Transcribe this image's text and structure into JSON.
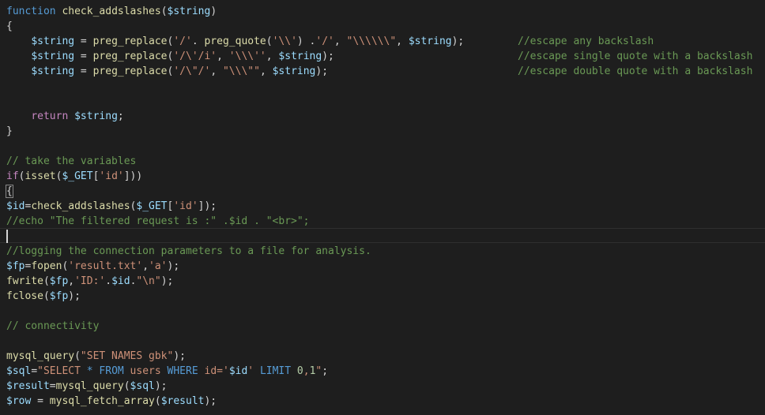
{
  "colors": {
    "background": "#1e1e1e",
    "text": "#d4d4d4",
    "keyword": "#569cd6",
    "control": "#c586c0",
    "function": "#dcdcaa",
    "variable": "#9cdcfe",
    "string": "#ce9178",
    "comment": "#6a9955",
    "number": "#b5cea8"
  },
  "code": {
    "l1": {
      "kw": "function",
      "fn": "check_addslashes",
      "open": "(",
      "var": "$string",
      "close": ")"
    },
    "l2": {
      "brace": "{"
    },
    "l3": {
      "indent": "    ",
      "var1": "$string",
      "eq": " = ",
      "fn1": "preg_replace",
      "p1": "(",
      "s1": "'/'",
      "dot1": ". ",
      "fn2": "preg_quote",
      "p2": "(",
      "s2": "'\\\\'",
      "p3": ") .",
      "s3": "'/'",
      "c1": ", ",
      "s4": "\"\\\\\\\\\\\\\"",
      "c2": ", ",
      "var2": "$string",
      "end": ");",
      "comment": "//escape any backslash"
    },
    "l4": {
      "indent": "    ",
      "var1": "$string",
      "eq": " = ",
      "fn1": "preg_replace",
      "p1": "(",
      "s1": "'/\\'/i'",
      "c1": ", ",
      "s2": "'\\\\\\''",
      "c2": ", ",
      "var2": "$string",
      "end": ");",
      "comment": "//escape single quote with a backslash"
    },
    "l5": {
      "indent": "    ",
      "var1": "$string",
      "eq": " = ",
      "fn1": "preg_replace",
      "p1": "(",
      "s1": "'/\\\"/'",
      "c1": ", ",
      "s2": "\"\\\\\\\"\"",
      "c2": ", ",
      "var2": "$string",
      "end": ");",
      "comment": "//escape double quote with a backslash"
    },
    "l8": {
      "indent": "    ",
      "kw": "return",
      "sp": " ",
      "var": "$string",
      "end": ";"
    },
    "l9": {
      "brace": "}"
    },
    "l11": {
      "comment": "// take the variables"
    },
    "l12": {
      "ctl": "if",
      "p1": "(",
      "fn": "isset",
      "p2": "(",
      "var": "$_GET",
      "b1": "[",
      "s": "'id'",
      "b2": "]))"
    },
    "l13": {
      "brace": "{"
    },
    "l14": {
      "var1": "$id",
      "eq": "=",
      "fn": "check_addslashes",
      "p1": "(",
      "var2": "$_GET",
      "b1": "[",
      "s": "'id'",
      "b2": "]);"
    },
    "l15": {
      "comment": "//echo \"The filtered request is :\" .$id . \"<br>\";"
    },
    "l17": {
      "comment": "//logging the connection parameters to a file for analysis."
    },
    "l18": {
      "var": "$fp",
      "eq": "=",
      "fn": "fopen",
      "p1": "(",
      "s1": "'result.txt'",
      "c": ",",
      "s2": "'a'",
      "end": ");"
    },
    "l19": {
      "fn": "fwrite",
      "p1": "(",
      "var1": "$fp",
      "c": ",",
      "s1": "'ID:'",
      "dot1": ".",
      "var2": "$id",
      "dot2": ".",
      "s2": "\"\\n\"",
      "end": ");"
    },
    "l20": {
      "fn": "fclose",
      "p1": "(",
      "var": "$fp",
      "end": ");"
    },
    "l22": {
      "comment": "// connectivity"
    },
    "l24": {
      "fn": "mysql_query",
      "p1": "(",
      "s": "\"SET NAMES gbk\"",
      "end": ");"
    },
    "l25": {
      "var": "$sql",
      "eq": "=",
      "s1": "\"SELECT ",
      "k1": "*",
      "s2": " ",
      "k2": "FROM",
      "s3": " users ",
      "k3": "WHERE",
      "s4": " id=",
      "s5": "'",
      "v2": "$id",
      "s6": "' ",
      "k4": "LIMIT",
      "s7": " ",
      "n1": "0",
      "s8": ",",
      "n2": "1",
      "s9": "\"",
      "end": ";"
    },
    "l26": {
      "var1": "$result",
      "eq": "=",
      "fn": "mysql_query",
      "p1": "(",
      "var2": "$sql",
      "end": ");"
    },
    "l27": {
      "var1": "$row",
      "eq": " = ",
      "fn": "mysql_fetch_array",
      "p1": "(",
      "var2": "$result",
      "end": ");"
    }
  }
}
